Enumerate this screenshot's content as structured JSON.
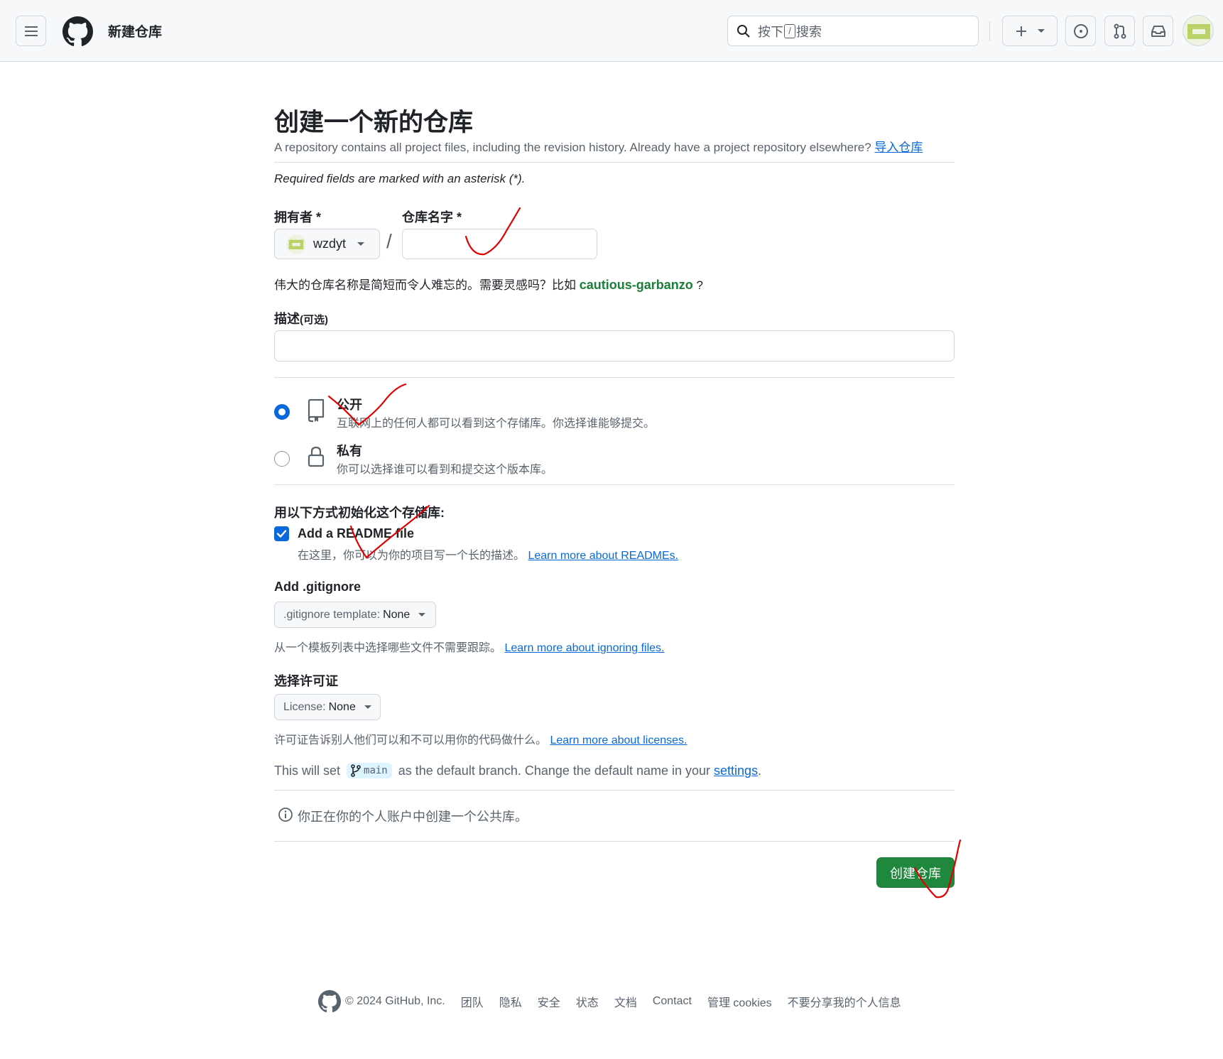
{
  "header": {
    "title": "新建仓库",
    "search_text": "按下",
    "search_key": "/",
    "search_suffix": "搜索"
  },
  "page": {
    "title": "创建一个新的仓库",
    "subtitle": "A repository contains all project files, including the revision history. Already have a project repository elsewhere? ",
    "import_link": "导入仓库",
    "required_note": "Required fields are marked with an asterisk (*)."
  },
  "owner": {
    "label": "拥有者",
    "asterisk": "*",
    "value": "wzdyt"
  },
  "separator": "/",
  "repo_name": {
    "label": "仓库名字",
    "asterisk": "*",
    "value": ""
  },
  "name_hint": {
    "prefix": "伟大的仓库名称是简短而令人难忘的。需要灵感吗？比如 ",
    "suggestion": "cautious-garbanzo",
    "suffix": " ?"
  },
  "description": {
    "label": "描述",
    "optional": "(可选)",
    "value": ""
  },
  "visibility": {
    "public": {
      "title": "公开",
      "desc": "互联网上的任何人都可以看到这个存储库。你选择谁能够提交。",
      "selected": true
    },
    "private": {
      "title": "私有",
      "desc": "你可以选择谁可以看到和提交这个版本库。",
      "selected": false
    }
  },
  "init": {
    "heading": "用以下方式初始化这个存储库:",
    "readme_label": "Add a README file",
    "readme_checked": true,
    "readme_desc": "在这里，你可以为你的项目写一个长的描述。",
    "readme_link": "Learn more about READMEs."
  },
  "gitignore": {
    "heading": "Add .gitignore",
    "select_prefix": ".gitignore template: ",
    "select_value": "None",
    "desc": "从一个模板列表中选择哪些文件不需要跟踪。",
    "link": "Learn more about ignoring files."
  },
  "license": {
    "heading": "选择许可证",
    "select_prefix": "License: ",
    "select_value": "None",
    "desc": "许可证告诉别人他们可以和不可以用你的代码做什么。",
    "link": "Learn more about licenses."
  },
  "branch": {
    "prefix": "This will set ",
    "name": "main",
    "middle": " as the default branch. Change the default name in your ",
    "settings_link": "settings",
    "suffix": "."
  },
  "notice": "你正在你的个人账户中创建一个公共库。",
  "submit": "创建仓库",
  "footer": {
    "copyright": "© 2024 GitHub, Inc.",
    "links": [
      "团队",
      "隐私",
      "安全",
      "状态",
      "文档",
      "Contact",
      "管理 cookies",
      "不要分享我的个人信息"
    ]
  },
  "colors": {
    "accent": "#0969da",
    "success": "#1f883d",
    "suggestion": "#1a7f37",
    "annotation": "#e00000"
  }
}
